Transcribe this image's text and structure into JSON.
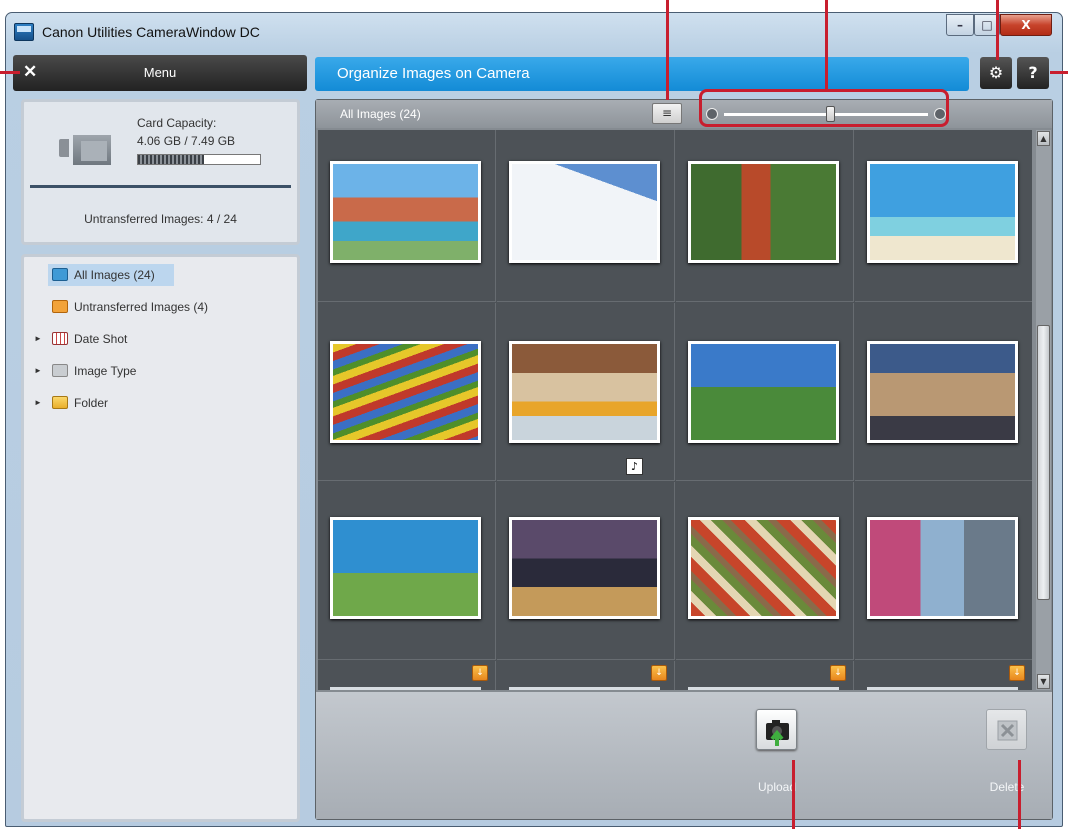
{
  "window": {
    "title": "Canon Utilities CameraWindow DC",
    "minimize_glyph": "–",
    "maximize_glyph": "□",
    "close_glyph": "X"
  },
  "menu": {
    "close_glyph": "✕",
    "label": "Menu"
  },
  "card": {
    "capacity_label": "Card Capacity:",
    "capacity_value": "4.06 GB  /  7.49 GB",
    "capacity_used_fraction": 0.54,
    "untransferred": "Untransferred Images: 4 / 24"
  },
  "tree": {
    "items": [
      {
        "label": "All Images (24)",
        "icon": "all-images-icon",
        "selected": true
      },
      {
        "label": "Untransferred Images (4)",
        "icon": "untransferred-icon",
        "selected": false
      },
      {
        "label": "Date Shot",
        "icon": "calendar-icon",
        "expandable": true
      },
      {
        "label": "Image Type",
        "icon": "image-type-icon",
        "expandable": true
      },
      {
        "label": "Folder",
        "icon": "folder-icon",
        "expandable": true
      }
    ]
  },
  "header": {
    "title": "Organize Images on Camera",
    "settings_glyph": "⚙",
    "help_glyph": "?"
  },
  "gallery": {
    "count_label": "All Images (24)",
    "list_view_glyph": "≡",
    "zoom_level": 0.52,
    "note_glyph": "♪",
    "new_glyph": "↓"
  },
  "actions": {
    "upload_label": "Upload",
    "delete_label": "Delete"
  },
  "colors": {
    "accent": "#1e96de",
    "callout": "#c81e2e",
    "badge": "#f0a030"
  }
}
